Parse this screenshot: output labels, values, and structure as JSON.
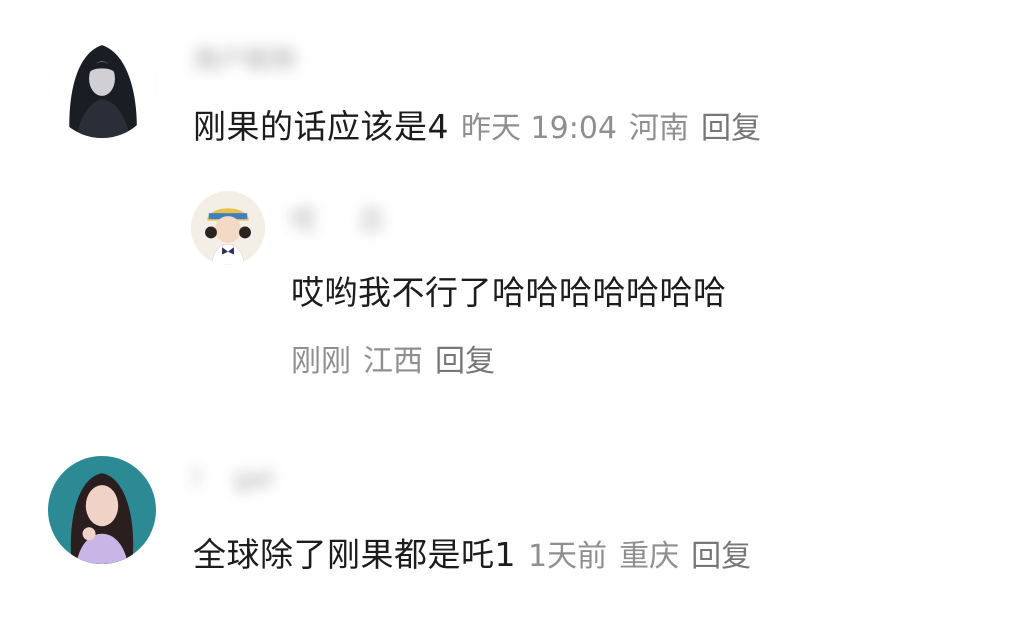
{
  "comments": [
    {
      "username": "用户昵称",
      "text": "刚果的话应该是4",
      "time": "昨天 19:04",
      "location": "河南",
      "reply_label": "回复",
      "replies": [
        {
          "username": "哎     吕",
          "text": "哎哟我不行了哈哈哈哈哈哈哈",
          "time": "刚刚",
          "location": "江西",
          "reply_label": "回复"
        }
      ]
    },
    {
      "username": "l    gal",
      "text": "全球除了刚果都是吒1",
      "time": "1天前",
      "location": "重庆",
      "reply_label": "回复"
    }
  ],
  "icons": {
    "avatar_1": "user-avatar-dark-hair-icon",
    "avatar_2": "user-avatar-cartoon-girl-icon",
    "avatar_3": "user-avatar-woman-photo-icon"
  },
  "colors": {
    "text": "#1c1c1c",
    "meta": "#8f8f8f",
    "background": "#ffffff"
  }
}
